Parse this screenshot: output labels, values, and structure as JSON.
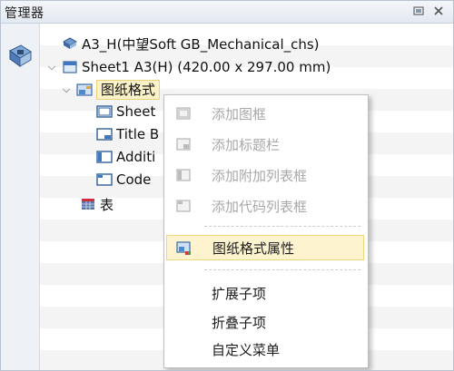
{
  "panel": {
    "title": "管理器",
    "pin_icon": "pin-icon",
    "close_icon": "close-icon"
  },
  "tree": {
    "root": {
      "label": "A3_H(中望Soft GB_Mechanical_chs)",
      "icon": "drawing-template-icon"
    },
    "sheet": {
      "label": "Sheet1 A3(H) (420.00 x 297.00 mm)",
      "icon": "sheet-icon"
    },
    "format": {
      "label": "图纸格式",
      "icon": "sheet-format-icon"
    },
    "children": [
      {
        "label": "Sheet",
        "icon": "frame-icon"
      },
      {
        "label": "Title B",
        "icon": "title-block-icon"
      },
      {
        "label": "Additi",
        "icon": "additional-table-icon"
      },
      {
        "label": "Code",
        "icon": "code-table-icon"
      }
    ],
    "table": {
      "label": "表",
      "icon": "table-icon"
    }
  },
  "context_menu": {
    "items": [
      {
        "label": "添加图框",
        "enabled": false,
        "icon": "add-frame-icon"
      },
      {
        "label": "添加标题栏",
        "enabled": false,
        "icon": "add-title-block-icon"
      },
      {
        "label": "添加附加列表框",
        "enabled": false,
        "icon": "add-additional-list-icon"
      },
      {
        "label": "添加代码列表框",
        "enabled": false,
        "icon": "add-code-list-icon"
      },
      {
        "label": "图纸格式属性",
        "enabled": true,
        "highlighted": true,
        "icon": "format-properties-icon"
      },
      {
        "label": "扩展子项",
        "enabled": true
      },
      {
        "label": "折叠子项",
        "enabled": true
      },
      {
        "label": "自定义菜单",
        "enabled": true
      }
    ]
  },
  "colors": {
    "selection_fill": "#fbf2c8",
    "menu_hover_fill": "#fdf4cf",
    "disabled_text": "#a8a8a8"
  }
}
